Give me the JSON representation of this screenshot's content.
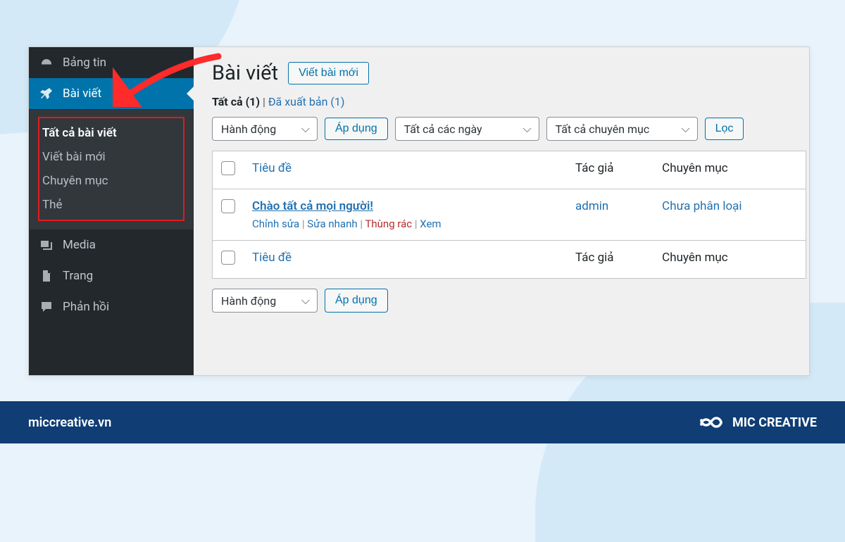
{
  "sidebar": {
    "menu": [
      {
        "label": "Bảng tin",
        "icon": "dashboard"
      },
      {
        "label": "Bài viết",
        "icon": "pin"
      },
      {
        "label": "Media",
        "icon": "media"
      },
      {
        "label": "Trang",
        "icon": "page"
      },
      {
        "label": "Phản hồi",
        "icon": "comment"
      }
    ],
    "submenu": [
      {
        "label": "Tất cả bài viết",
        "current": true
      },
      {
        "label": "Viết bài mới"
      },
      {
        "label": "Chuyên mục"
      },
      {
        "label": "Thẻ"
      }
    ]
  },
  "page": {
    "title": "Bài viết",
    "add_new": "Viết bài mới",
    "filters": {
      "all_label": "Tất cả",
      "all_count": "(1)",
      "separator": " | ",
      "published_label": "Đã xuất bản (1)"
    }
  },
  "toolbar": {
    "bulk_action": "Hành động",
    "apply": "Áp dụng",
    "date_filter": "Tất cả các ngày",
    "cat_filter": "Tất cả chuyên mục",
    "filter": "Lọc"
  },
  "table": {
    "columns": {
      "title": "Tiêu đề",
      "author": "Tác giả",
      "category": "Chuyên mục"
    },
    "rows": [
      {
        "title": "Chào tất cả mọi người!",
        "author": "admin",
        "category": "Chưa phân loại",
        "actions": {
          "edit": "Chỉnh sửa",
          "quick": "Sửa nhanh",
          "trash": "Thùng rác",
          "view": "Xem"
        }
      }
    ]
  },
  "footer": {
    "site": "miccreative.vn",
    "brand": "MIC CREATIVE"
  }
}
